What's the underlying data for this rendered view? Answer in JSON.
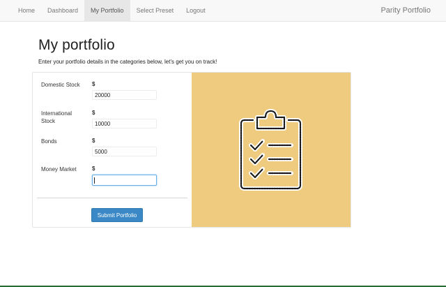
{
  "nav": {
    "items": [
      {
        "label": "Home",
        "active": false
      },
      {
        "label": "Dashboard",
        "active": false
      },
      {
        "label": "My Portfolio",
        "active": true
      },
      {
        "label": "Select Preset",
        "active": false
      },
      {
        "label": "Logout",
        "active": false
      }
    ],
    "brand": "Parity Portfolio"
  },
  "header": {
    "title": "My portfolio",
    "subtitle": "Enter your portfolio details in the categories below, let's get you on track!"
  },
  "form": {
    "fields": [
      {
        "label": "Domestic Stock",
        "currency": "$",
        "value": "20000"
      },
      {
        "label": "International Stock",
        "currency": "$",
        "value": "10000"
      },
      {
        "label": "Bonds",
        "currency": "$",
        "value": "5000"
      },
      {
        "label": "Money Market",
        "currency": "$",
        "value": ""
      }
    ],
    "submit_label": "Submit Portfolio"
  },
  "illustration": {
    "icon": "clipboard-checklist-icon",
    "background": "#efcb7f"
  },
  "colors": {
    "accent": "#3a88c5",
    "focus": "#66afe9",
    "panel": "#efcb7f"
  }
}
